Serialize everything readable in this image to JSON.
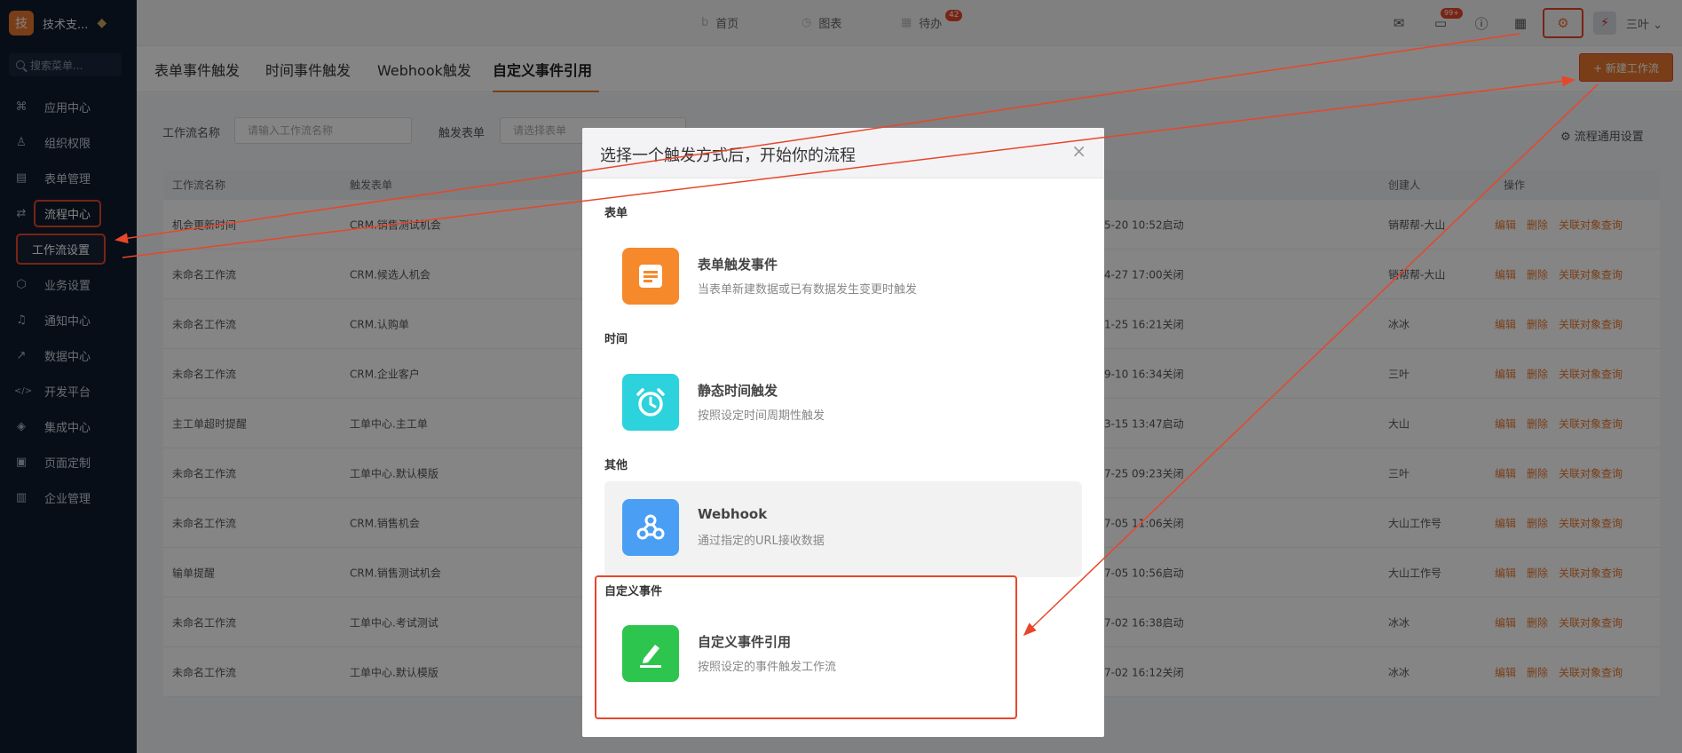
{
  "sidebar": {
    "logo_char": "技",
    "brand": "技术支...",
    "search_placeholder": "搜索菜单...",
    "items": [
      {
        "label": "应用中心",
        "icon": "⌘"
      },
      {
        "label": "组织权限",
        "icon": "♙"
      },
      {
        "label": "表单管理",
        "icon": "▤"
      },
      {
        "label": "流程中心",
        "icon": "⇄"
      },
      {
        "label": "工作流设置",
        "icon": ""
      },
      {
        "label": "业务设置",
        "icon": "⬡"
      },
      {
        "label": "通知中心",
        "icon": "♫"
      },
      {
        "label": "数据中心",
        "icon": "↗"
      },
      {
        "label": "开发平台",
        "icon": "</>"
      },
      {
        "label": "集成中心",
        "icon": "◈"
      },
      {
        "label": "页面定制",
        "icon": "▣"
      },
      {
        "label": "企业管理",
        "icon": "▥"
      }
    ]
  },
  "topbar": {
    "tabs": [
      {
        "label": "首页",
        "icon": "b"
      },
      {
        "label": "图表",
        "icon": "◷"
      },
      {
        "label": "待办",
        "icon": "▦",
        "badge": "42"
      }
    ],
    "chat_badge": "99+",
    "user": "三叶"
  },
  "content_tabs": [
    "表单事件触发",
    "时间事件触发",
    "Webhook触发",
    "自定义事件引用"
  ],
  "new_button": "+ 新建工作流",
  "filters": {
    "name_label": "工作流名称",
    "name_placeholder": "请输入工作流名称",
    "form_label": "触发表单",
    "form_placeholder": "请选择表单"
  },
  "settings_link": "⚙ 流程通用设置",
  "table": {
    "headers": [
      "工作流名称",
      "触发表单",
      "创建人",
      "操作"
    ],
    "rows": [
      {
        "name": "机会更新时间",
        "form": "CRM.销售测试机会",
        "status": "5-20 10:52启动",
        "creator": "销帮帮-大山"
      },
      {
        "name": "未命名工作流",
        "form": "CRM.候选人机会",
        "status": "4-27 17:00关闭",
        "creator": "销帮帮-大山"
      },
      {
        "name": "未命名工作流",
        "form": "CRM.认购单",
        "status": "1-25 16:21关闭",
        "creator": "冰冰"
      },
      {
        "name": "未命名工作流",
        "form": "CRM.企业客户",
        "status": "9-10 16:34关闭",
        "creator": "三叶"
      },
      {
        "name": "主工单超时提醒",
        "form": "工单中心.主工单",
        "status": "3-15 13:47启动",
        "creator": "大山"
      },
      {
        "name": "未命名工作流",
        "form": "工单中心.默认模版",
        "status": "7-25 09:23关闭",
        "creator": "三叶"
      },
      {
        "name": "未命名工作流",
        "form": "CRM.销售机会",
        "status": "7-05 11:06关闭",
        "creator": "大山工作号"
      },
      {
        "name": "输单提醒",
        "form": "CRM.销售测试机会",
        "status": "7-05 10:56启动",
        "creator": "大山工作号"
      },
      {
        "name": "未命名工作流",
        "form": "工单中心.考试测试",
        "status": "7-02 16:38启动",
        "creator": "冰冰"
      },
      {
        "name": "未命名工作流",
        "form": "工单中心.默认模版",
        "status": "7-02 16:12关闭",
        "creator": "冰冰"
      }
    ],
    "ops": [
      "编辑",
      "删除",
      "关联对象查询"
    ]
  },
  "modal": {
    "title": "选择一个触发方式后，开始你的流程",
    "sections": [
      {
        "heading": "表单",
        "option_title": "表单触发事件",
        "option_desc": "当表单新建数据或已有数据发生变更时触发",
        "color": "#f5892b",
        "icon": "form-icon"
      },
      {
        "heading": "时间",
        "option_title": "静态时间触发",
        "option_desc": "按照设定时间周期性触发",
        "color": "#2cd2dc",
        "icon": "alarm-clock-icon"
      },
      {
        "heading": "其他",
        "option_title": "Webhook",
        "option_desc": "通过指定的URL接收数据",
        "color": "#4a9ff5",
        "icon": "webhook-icon"
      },
      {
        "heading": "自定义事件",
        "option_title": "自定义事件引用",
        "option_desc": "按照设定的事件触发工作流",
        "color": "#2dc54e",
        "icon": "pen-icon"
      }
    ]
  },
  "colors": {
    "accent": "#e8772e",
    "annotation": "#e8462a",
    "sidebar": "#0f1b2d"
  }
}
